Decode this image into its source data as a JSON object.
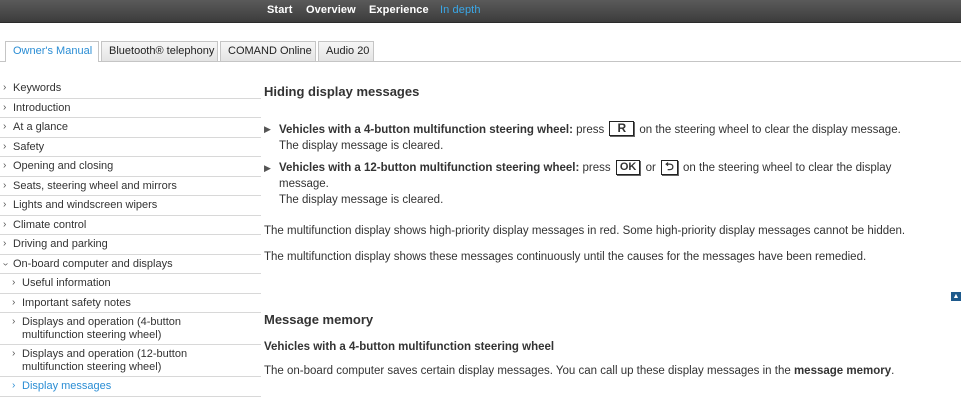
{
  "topnav": {
    "items": [
      {
        "label": "Start",
        "active": false
      },
      {
        "label": "Overview",
        "active": false
      },
      {
        "label": "Experience",
        "active": false
      },
      {
        "label": "In depth",
        "active": true
      }
    ]
  },
  "tabs": [
    {
      "label": "Owner's Manual",
      "active": true
    },
    {
      "label": "Bluetooth® telephony",
      "active": false
    },
    {
      "label": "COMAND Online",
      "active": false
    },
    {
      "label": "Audio 20",
      "active": false
    }
  ],
  "sidebar": {
    "items": [
      {
        "label": "Keywords"
      },
      {
        "label": "Introduction"
      },
      {
        "label": "At a glance"
      },
      {
        "label": "Safety"
      },
      {
        "label": "Opening and closing"
      },
      {
        "label": "Seats, steering wheel and mirrors"
      },
      {
        "label": "Lights and windscreen wipers"
      },
      {
        "label": "Climate control"
      },
      {
        "label": "Driving and parking"
      },
      {
        "label": "On-board computer and displays"
      },
      {
        "label": "Useful information"
      },
      {
        "label": "Important safety notes"
      },
      {
        "label": "Displays and operation (4-button multifunction steering wheel)"
      },
      {
        "label": "Displays and operation (12-button multifunction steering wheel)"
      },
      {
        "label": "Display messages"
      }
    ]
  },
  "content": {
    "section1_title": "Hiding display messages",
    "step1": {
      "bold": "Vehicles with a 4-button multifunction steering wheel:",
      "pre": "press",
      "key": "R",
      "post": "on the steering wheel to clear the display message.",
      "result": "The display message is cleared."
    },
    "step2": {
      "bold": "Vehicles with a 12-button multifunction steering wheel:",
      "pre": "press",
      "key1": "OK",
      "or": "or",
      "key2": "⮌",
      "post": "on the steering wheel to clear the display message.",
      "result": "The display message is cleared."
    },
    "para1": "The multifunction display shows high-priority display messages in red. Some high-priority display messages cannot be hidden.",
    "para2": "The multifunction display shows these messages continuously until the causes for the messages have been remedied.",
    "to_top_icon": "▲",
    "section2_title": "Message memory",
    "subheading": "Vehicles with a 4-button multifunction steering wheel",
    "para3_pre": "The on-board computer saves certain display messages. You can call up these display messages in the",
    "para3_bold": "message memory",
    "para3_post": "."
  },
  "icons": {
    "chevron": "›",
    "step_arrow": "▶"
  },
  "colors": {
    "accent": "#2a8dd4",
    "topbar": "#474747",
    "topnav_active": "#3aa8e8"
  }
}
